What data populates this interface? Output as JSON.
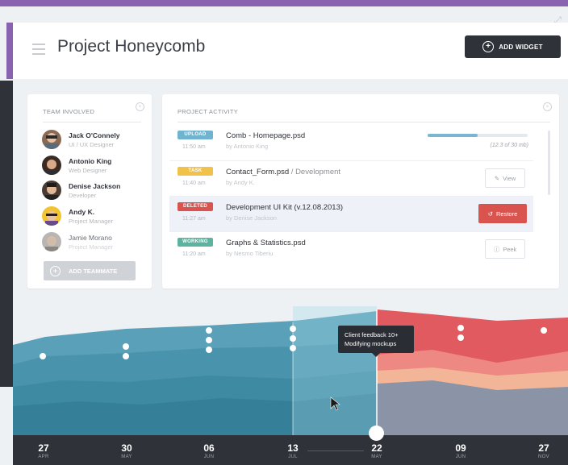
{
  "header": {
    "title": "Project Honeycomb",
    "add_widget_label": "ADD WIDGET"
  },
  "team": {
    "title": "TEAM INVOLVED",
    "members": [
      {
        "name": "Jack O'Connely",
        "role": "UI / UX Designer"
      },
      {
        "name": "Antonio King",
        "role": "Web Designer"
      },
      {
        "name": "Denise Jackson",
        "role": "Developer"
      },
      {
        "name": "Andy K.",
        "role": "Project Manager"
      },
      {
        "name": "Jamie Morano",
        "role": "Project Manager"
      }
    ],
    "add_label": "ADD TEAMMATE"
  },
  "activity": {
    "title": "PROJECT ACTIVITY",
    "rows": [
      {
        "badge": "UPLOAD",
        "badge_color": "#6fb3cf",
        "time": "11:50 am",
        "file": "Comb - Homepage.psd",
        "file_sub": "",
        "by": "by Antonio King",
        "progress": 0.5,
        "progress_text": "(12.3 of 30 mb)"
      },
      {
        "badge": "TASK",
        "badge_color": "#f0c24b",
        "time": "11:40 am",
        "file": "Contact_Form.psd",
        "file_sub": " / Development",
        "by": "by Andy K.",
        "action": "View"
      },
      {
        "badge": "DELETED",
        "badge_color": "#d9534f",
        "time": "11:27 am",
        "file": "Development UI Kit (v.12.08.2013)",
        "file_sub": "",
        "by": "by Denise Jackson",
        "action": "Restore"
      },
      {
        "badge": "WORKING",
        "badge_color": "#5cb3a0",
        "time": "11:20 am",
        "file": "Graphs & Statistics.psd",
        "file_sub": "",
        "by": "by Nesmo Tiberiu",
        "action": "Peek"
      }
    ]
  },
  "timeline": {
    "tooltip_line1": "Client feedback 10+",
    "tooltip_line2": "Modifying mockups",
    "ticks": [
      {
        "day": "27",
        "month": "APR"
      },
      {
        "day": "30",
        "month": "MAY"
      },
      {
        "day": "06",
        "month": "JUN"
      },
      {
        "day": "13",
        "month": "JUL"
      },
      {
        "day": "22",
        "month": "MAY"
      },
      {
        "day": "09",
        "month": "JUN"
      },
      {
        "day": "27",
        "month": "NOV"
      }
    ]
  }
}
